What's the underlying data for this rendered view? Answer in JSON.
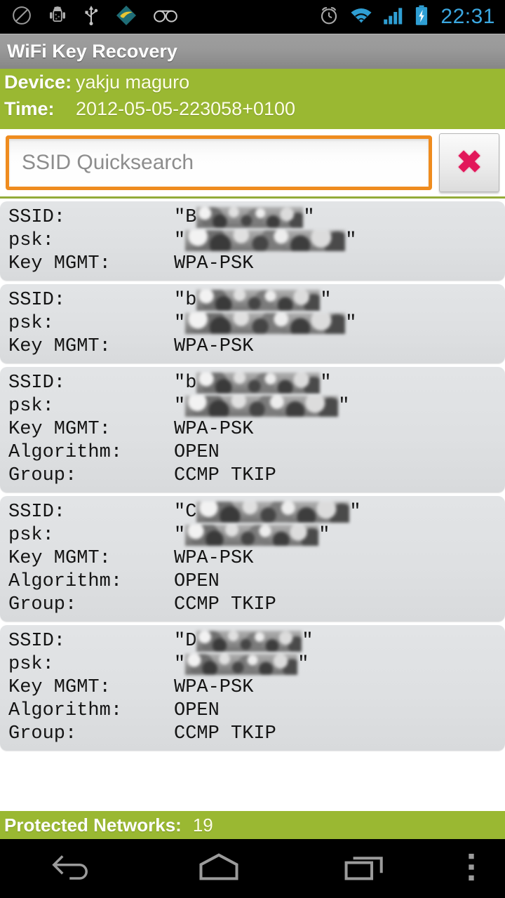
{
  "statusbar": {
    "left_icons": [
      {
        "name": "no-sim-icon",
        "glyph": "⊘"
      },
      {
        "name": "android-debug-icon",
        "glyph": "android"
      },
      {
        "name": "usb-icon",
        "glyph": "usb"
      },
      {
        "name": "app-notification-icon",
        "glyph": "app"
      },
      {
        "name": "voicemail-icon",
        "glyph": "voicemail"
      }
    ],
    "right_icons": [
      {
        "name": "alarm-clock-icon",
        "glyph": "alarm"
      },
      {
        "name": "wifi-icon",
        "glyph": "wifi"
      },
      {
        "name": "cell-signal-icon",
        "glyph": "signal"
      },
      {
        "name": "battery-charging-icon",
        "glyph": "battery"
      }
    ],
    "clock": "22:31",
    "clock_color": "#3ba7e0"
  },
  "app": {
    "title": "WiFi Key Recovery",
    "accent_green": "#9ab832",
    "accent_orange": "#ef8c1f",
    "clear_red": "#e2165a"
  },
  "info": {
    "device_label": "Device:",
    "device_value": "yakju maguro",
    "time_label": "Time:",
    "time_value": "2012-05-05-223058+0100"
  },
  "search": {
    "placeholder": "SSID Quicksearch",
    "value": "",
    "clear_icon": "✖"
  },
  "list": {
    "field_labels": {
      "ssid": "SSID:",
      "psk": "psk:",
      "keymgmt": "Key MGMT:",
      "algorithm": "Algorithm:",
      "group": "Group:"
    },
    "entries": [
      {
        "ssid_prefix": "B",
        "ssid_redacted_width": 152,
        "psk_redacted_width": 228,
        "key_mgmt": "WPA-PSK",
        "algorithm": null,
        "group": null
      },
      {
        "ssid_prefix": "b",
        "ssid_redacted_width": 176,
        "psk_redacted_width": 228,
        "key_mgmt": "WPA-PSK",
        "algorithm": null,
        "group": null
      },
      {
        "ssid_prefix": "b",
        "ssid_redacted_width": 176,
        "psk_redacted_width": 218,
        "key_mgmt": "WPA-PSK",
        "algorithm": "OPEN",
        "group": "CCMP TKIP"
      },
      {
        "ssid_prefix": "C",
        "ssid_redacted_width": 218,
        "psk_redacted_width": 190,
        "key_mgmt": "WPA-PSK",
        "algorithm": "OPEN",
        "group": "CCMP TKIP"
      },
      {
        "ssid_prefix": "D",
        "ssid_redacted_width": 150,
        "psk_redacted_width": 160,
        "key_mgmt": "WPA-PSK",
        "algorithm": "OPEN",
        "group": "CCMP TKIP"
      }
    ]
  },
  "footer": {
    "label": "Protected Networks:",
    "value": "19"
  },
  "navbar": {
    "back": "back-button",
    "home": "home-button",
    "recents": "recents-button",
    "menu": "overflow-menu-button"
  }
}
